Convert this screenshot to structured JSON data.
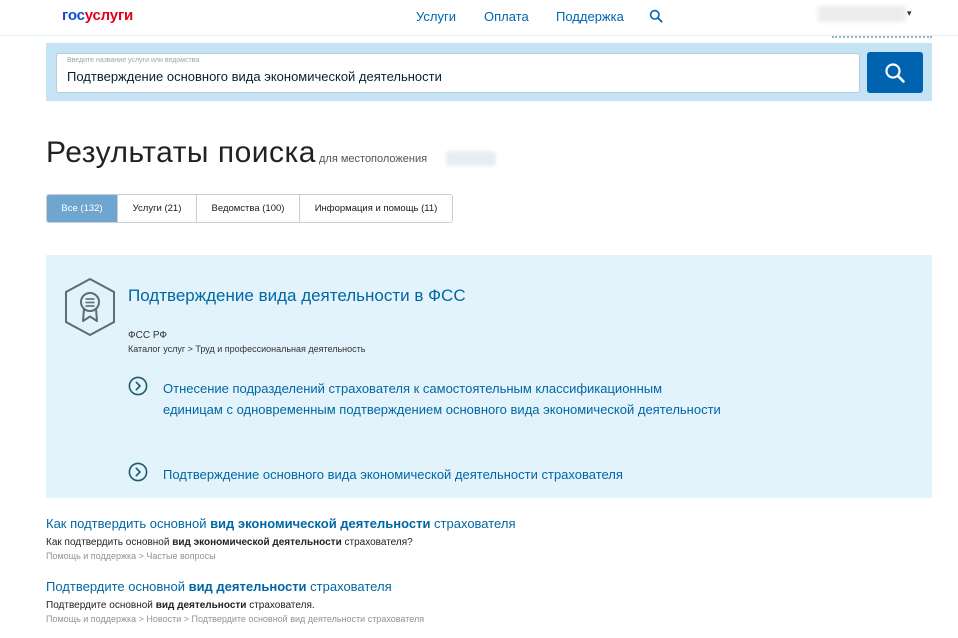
{
  "header": {
    "logo_part1": "гос",
    "logo_part2": "услуги",
    "nav": [
      {
        "label": "Услуги"
      },
      {
        "label": "Оплата"
      },
      {
        "label": "Поддержка"
      }
    ],
    "caret": "▾"
  },
  "search": {
    "hint": "Введите название услуги или ведомства",
    "value": "Подтверждение основного вида экономической деятельности"
  },
  "page": {
    "title": "Результаты поиска",
    "subtitle": "для местоположения"
  },
  "tabs": [
    {
      "label": "Все (132)",
      "active": true
    },
    {
      "label": "Услуги (21)",
      "active": false
    },
    {
      "label": "Ведомства (100)",
      "active": false
    },
    {
      "label": "Информация и помощь (11)",
      "active": false
    }
  ],
  "featured": {
    "title": "Подтверждение вида деятельности в ФСС",
    "org": "ФСС РФ",
    "breadcrumb": "Каталог услуг > Труд и профессиональная деятельность",
    "items": [
      {
        "text": "Отнесение подразделений страхователя к самостоятельным классификационным единицам с одновременным подтверждением основного вида экономической деятельности"
      },
      {
        "text": "Подтверждение основного вида экономической деятельности страхователя"
      }
    ]
  },
  "results": [
    {
      "title_pre": "Как подтвердить основной ",
      "title_bold": "вид экономической деятельности",
      "title_post": " страхователя",
      "desc_pre": "Как подтвердить основной ",
      "desc_bold": "вид экономической деятельности",
      "desc_post": " страхователя?",
      "breadcrumb": "Помощь и поддержка > Частые вопросы"
    },
    {
      "title_pre": "Подтвердите основной ",
      "title_bold": "вид деятельности",
      "title_post": " страхователя",
      "desc_pre": "Подтвердите основной ",
      "desc_bold": "вид деятельности",
      "desc_post": " страхователя.",
      "breadcrumb": "Помощь и поддержка > Новости > Подтвердите основной вид деятельности страхователя"
    }
  ],
  "colors": {
    "brand_blue": "#0d4cd3",
    "brand_red": "#e3001b",
    "link": "#0067a3",
    "search_button": "#0063b0",
    "tab_active": "#6ea6cf",
    "card_bg": "#e3f3fc"
  },
  "icons": {
    "search": "search-icon",
    "certificate": "certificate-icon",
    "chevron": "chevron-circle-icon"
  }
}
